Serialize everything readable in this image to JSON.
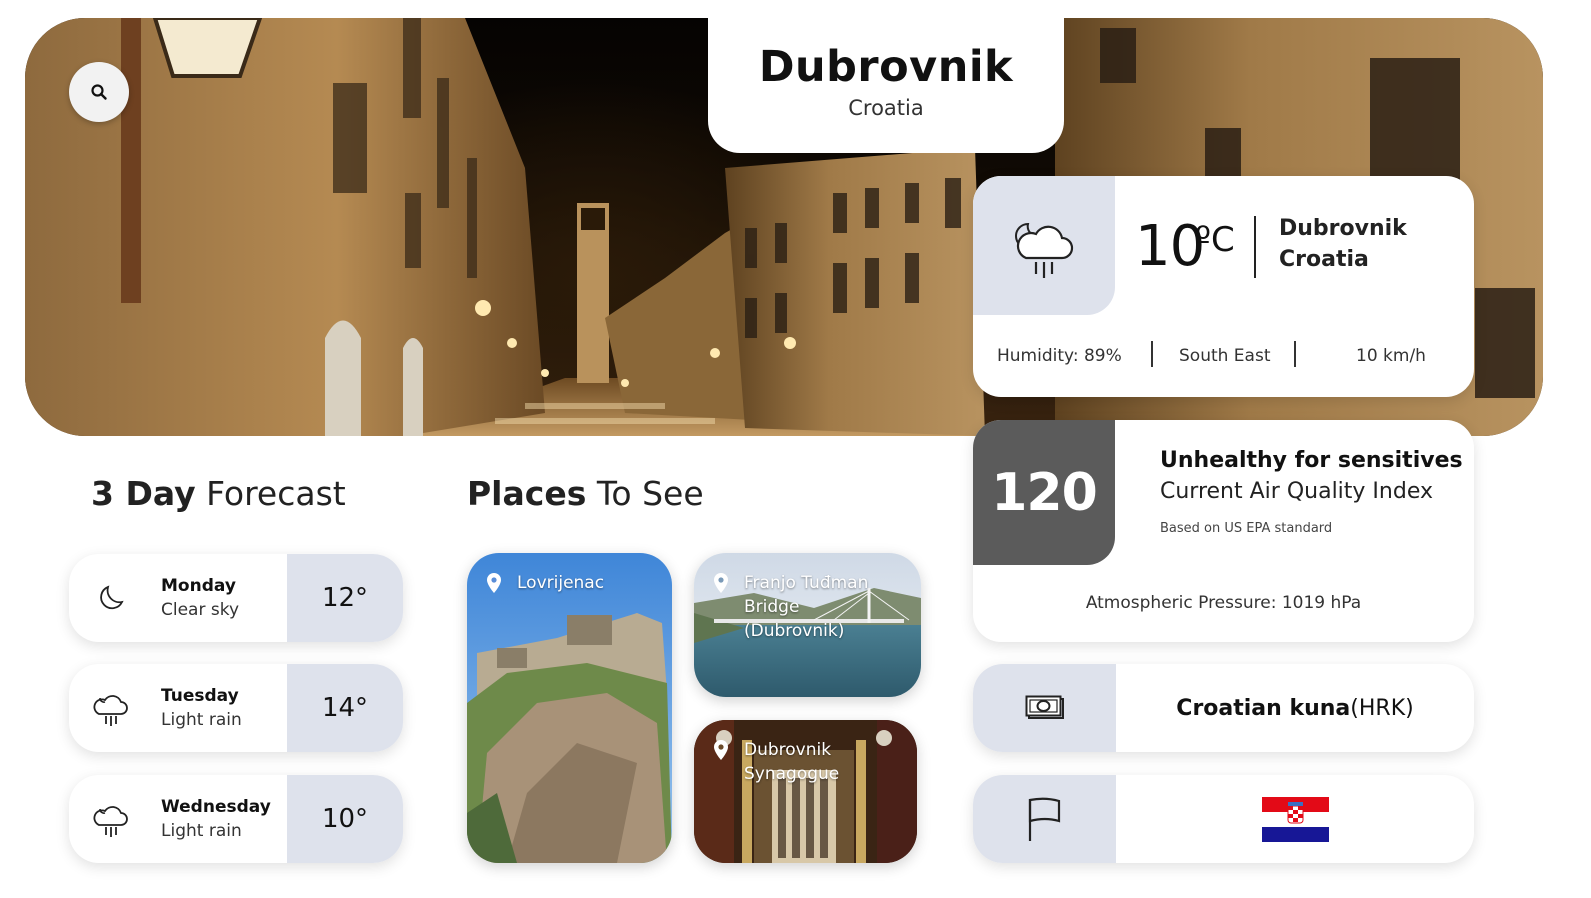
{
  "header": {
    "city": "Dubrovnik",
    "country": "Croatia"
  },
  "search": {
    "icon": "search-icon"
  },
  "current": {
    "temperature": "10",
    "unit": "ºC",
    "icon": "cloud-rain-moon-icon",
    "city": "Dubrovnik",
    "country": "Croatia",
    "humidity": "Humidity: 89%",
    "wind_direction": "South East",
    "wind_speed": "10 km/h"
  },
  "air_quality": {
    "aqi": "120",
    "level": "Unhealthy for sensitives",
    "label": "Current Air Quality Index",
    "standard": "Based on US EPA standard",
    "pressure": "Atmospheric Pressure: 1019 hPa"
  },
  "currency": {
    "icon": "banknote-icon",
    "name": "Croatian kuna",
    "code": " (HRK)"
  },
  "flag": {
    "icon": "flag-icon",
    "colors": [
      "#e30a17",
      "#ffffff",
      "#171796"
    ]
  },
  "forecast": {
    "title_bold": "3 Day",
    "title_rest": " Forecast",
    "days": [
      {
        "day": "Monday",
        "desc": "Clear sky",
        "temp": "12°",
        "icon": "moon-icon"
      },
      {
        "day": "Tuesday",
        "desc": "Light rain",
        "temp": "14°",
        "icon": "cloud-rain-icon"
      },
      {
        "day": "Wednesday",
        "desc": "Light rain",
        "temp": "10°",
        "icon": "cloud-rain-icon"
      }
    ]
  },
  "places": {
    "title_bold": "Places",
    "title_rest": " To See",
    "items": [
      {
        "name": "Lovrijenac",
        "icon": "location-pin-icon"
      },
      {
        "name": "Franjo Tuđman Bridge (Dubrovnik)",
        "icon": "location-pin-icon"
      },
      {
        "name": "Dubrovnik Synagogue",
        "icon": "location-pin-icon"
      }
    ]
  },
  "colors": {
    "panel_gray": "#dee2ec",
    "aqi_box": "#5b5b5b"
  }
}
